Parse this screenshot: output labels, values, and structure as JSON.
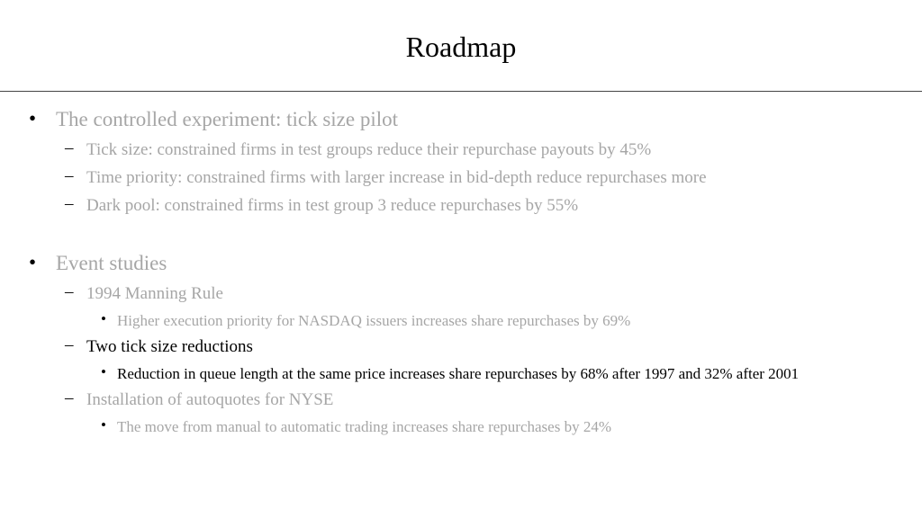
{
  "slide": {
    "title": "Roadmap",
    "colors": {
      "dimmed_text": "#a6a6a6",
      "active_text": "#000000",
      "markers": "#000000"
    },
    "markers": {
      "level1": "•",
      "level2": "–",
      "level3": "•"
    },
    "items": [
      {
        "level": 1,
        "state": "dimmed",
        "text": "The controlled experiment: tick size pilot"
      },
      {
        "level": 2,
        "state": "dimmed",
        "text": "Tick size: constrained firms in test groups reduce their repurchase payouts by 45%"
      },
      {
        "level": 2,
        "state": "dimmed",
        "text": "Time priority: constrained firms with larger increase in bid-depth reduce repurchases more"
      },
      {
        "level": 2,
        "state": "dimmed",
        "text": "Dark pool: constrained firms in test group 3 reduce repurchases by 55%"
      },
      {
        "level": 1,
        "state": "dimmed",
        "text": "Event studies"
      },
      {
        "level": 2,
        "state": "dimmed",
        "text": "1994 Manning Rule"
      },
      {
        "level": 3,
        "state": "dimmed",
        "text": "Higher execution priority for NASDAQ issuers increases share repurchases by 69%"
      },
      {
        "level": 2,
        "state": "active",
        "text": "Two tick size reductions"
      },
      {
        "level": 3,
        "state": "active",
        "text": "Reduction in queue length at the same price increases share repurchases by 68% after 1997 and 32% after 2001"
      },
      {
        "level": 2,
        "state": "dimmed",
        "text": "Installation of autoquotes for NYSE"
      },
      {
        "level": 3,
        "state": "dimmed",
        "text": "The move from manual to automatic trading increases share repurchases by 24%"
      }
    ]
  }
}
